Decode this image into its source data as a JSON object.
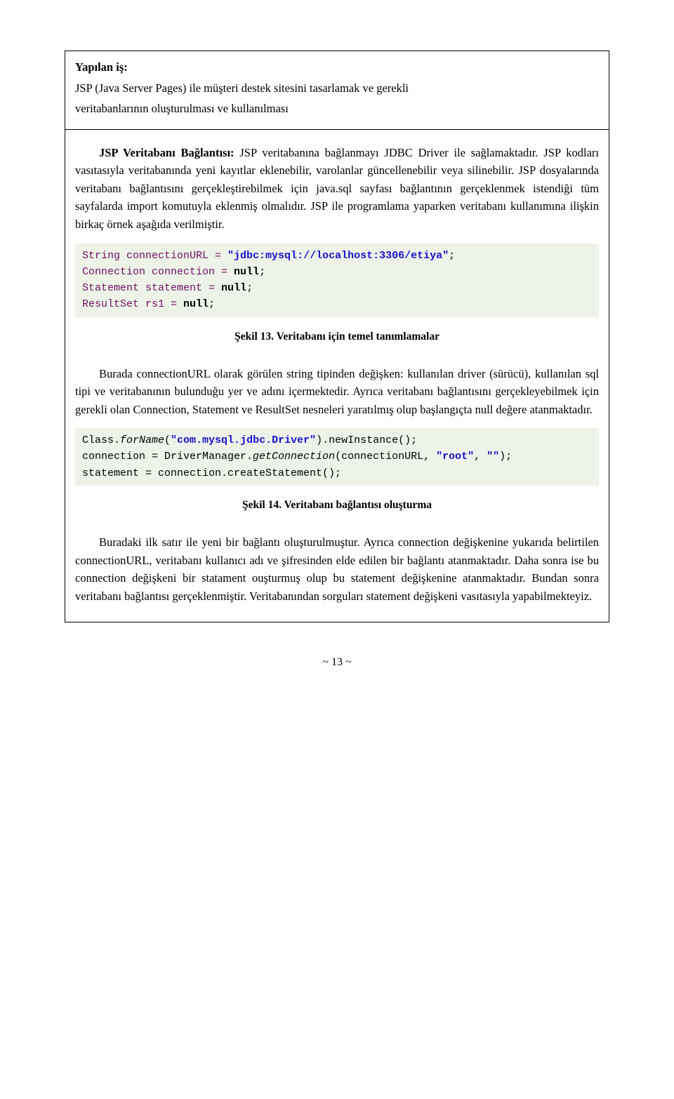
{
  "top_box": {
    "heading": "Yapılan iş:",
    "line1": "JSP (Java Server Pages) ile müşteri destek sitesini tasarlamak ve gerekli",
    "line2": "veritabanlarının oluşturulması ve kullanılması"
  },
  "para1_prefix": "JSP Veritabanı Bağlantısı: ",
  "para1_rest": "JSP veritabanına bağlanmayı JDBC Driver ile sağlamaktadır. JSP kodları vasıtasıyla veritabanında yeni kayıtlar eklenebilir, varolanlar güncellenebilir veya silinebilir. JSP dosyalarında veritabanı bağlantısını gerçekleştirebilmek için java.sql sayfası bağlantının gerçeklenmek istendiği tüm sayfalarda import komutuyla eklenmiş olmalıdır. JSP ile programlama yaparken veritabanı kullanımına ilişkin birkaç örnek aşağıda verilmiştir.",
  "code1": {
    "l1_a": "String connectionURL = ",
    "l1_b": "\"jdbc:mysql://localhost:3306/etiya\"",
    "l1_c": ";",
    "l2_a": "Connection connection = ",
    "l2_b": "null",
    "l2_c": ";",
    "l3_a": "Statement statement = ",
    "l3_b": "null",
    "l3_c": ";",
    "l4_a": "ResultSet rs1 = ",
    "l4_b": "null",
    "l4_c": ";"
  },
  "caption1": "Şekil 13. Veritabanı için temel tanımlamalar",
  "para2": "Burada connectionURL olarak görülen string tipinden değişken: kullanılan driver (sürücü), kullanılan sql tipi ve veritabanının bulunduğu yer ve adını içermektedir. Ayrıca veritabanı bağlantısını gerçekleyebilmek için gerekli olan Connection, Statement ve ResultSet nesneleri yaratılmış olup başlangıçta null değere atanmaktadır.",
  "code2": {
    "l1_a": "Class.",
    "l1_b": "forName",
    "l1_c": "(",
    "l1_d": "\"com.mysql.jdbc.Driver\"",
    "l1_e": ").newInstance();",
    "l2_a": "connection = DriverManager.",
    "l2_b": "getConnection",
    "l2_c": "(connectionURL, ",
    "l2_d": "\"root\"",
    "l2_e": ", ",
    "l2_f": "\"\"",
    "l2_g": ");",
    "l3": "statement = connection.createStatement();"
  },
  "caption2": "Şekil 14. Veritabanı bağlantısı oluşturma",
  "para3": "Buradaki ilk satır ile yeni bir bağlantı oluşturulmuştur. Ayrıca connection değişkenine yukarıda belirtilen connectionURL, veritabanı kullanıcı adı ve şifresinden elde edilen bir bağlantı atanmaktadır. Daha sonra ise bu connection değişkeni bir statament ouşturmuş olup bu statement değişkenine atanmaktadır. Bundan sonra veritabanı bağlantısı gerçeklenmiştir. Veritabanından sorguları statement değişkeni vasıtasıyla yapabilmekteyiz.",
  "page_number": "13"
}
